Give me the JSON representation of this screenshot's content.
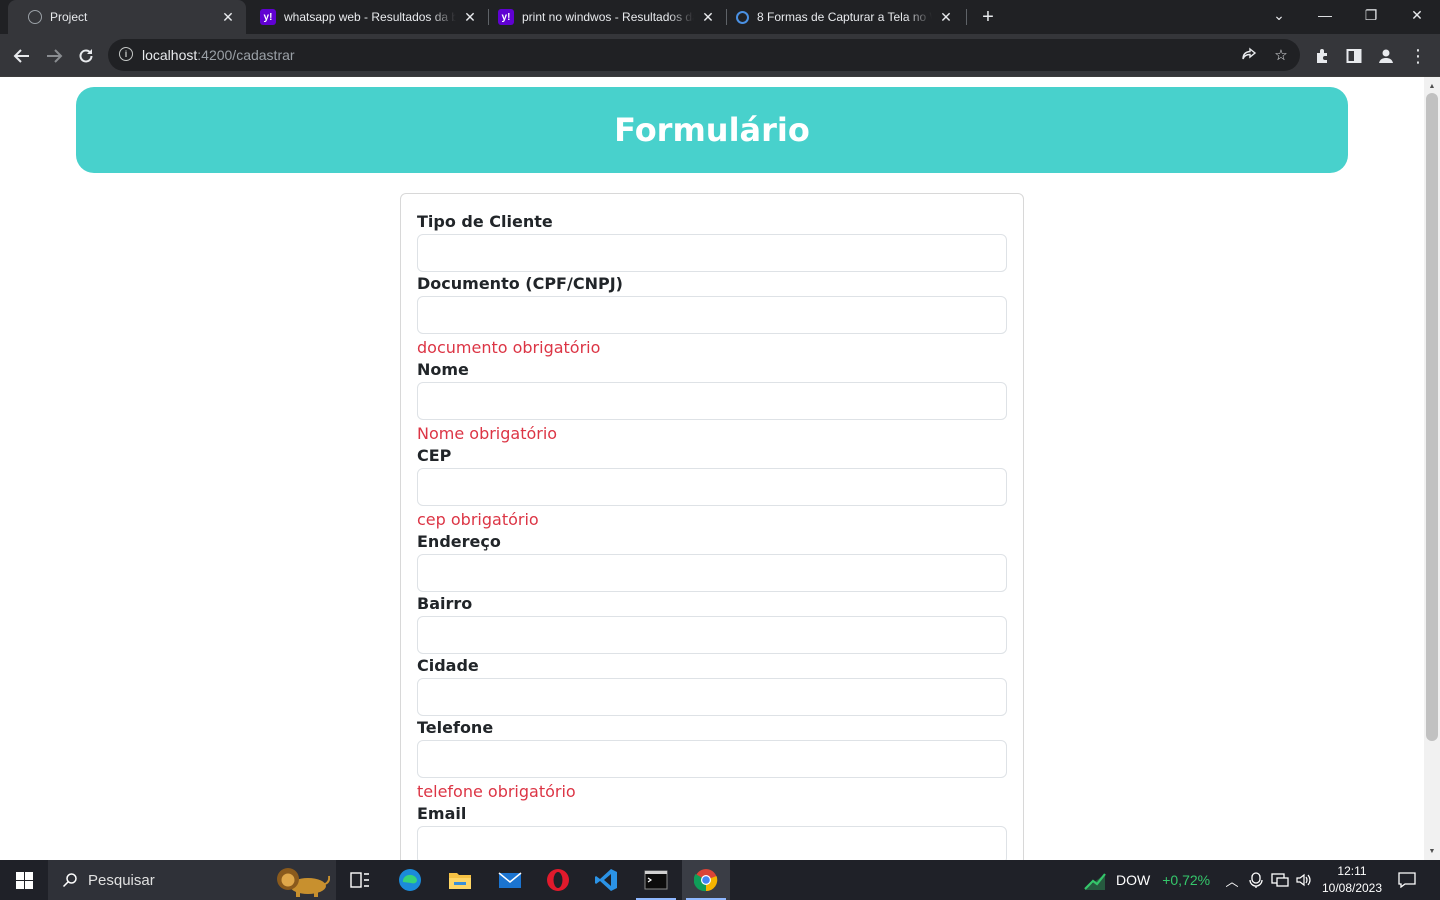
{
  "browser": {
    "tabs": [
      {
        "title": "Project",
        "favicon": "globe-icon"
      },
      {
        "title": "whatsapp web - Resultados da busca",
        "favicon": "yahoo-icon"
      },
      {
        "title": "print no windwos - Resultados da busca",
        "favicon": "yahoo-icon"
      },
      {
        "title": "8 Formas de Capturar a Tela no Windows",
        "favicon": "site-icon"
      }
    ],
    "yahoo_glyph": "y!",
    "url_host": "localhost",
    "url_path": ":4200/cadastrar"
  },
  "page": {
    "header_title": "Formulário",
    "fields": [
      {
        "label": "Tipo de Cliente",
        "value": "",
        "error": ""
      },
      {
        "label": "Documento (CPF/CNPJ)",
        "value": "",
        "error": "documento obrigatório"
      },
      {
        "label": "Nome",
        "value": "",
        "error": "Nome obrigatório"
      },
      {
        "label": "CEP",
        "value": "",
        "error": "cep obrigatório"
      },
      {
        "label": "Endereço",
        "value": "",
        "error": ""
      },
      {
        "label": "Bairro",
        "value": "",
        "error": ""
      },
      {
        "label": "Cidade",
        "value": "",
        "error": ""
      },
      {
        "label": "Telefone",
        "value": "",
        "error": "telefone obrigatório"
      },
      {
        "label": "Email",
        "value": "",
        "error": ""
      }
    ]
  },
  "taskbar": {
    "search_placeholder": "Pesquisar",
    "ticker_name": "DOW",
    "ticker_change": "+0,72%",
    "time": "12:11",
    "date": "10/08/2023"
  },
  "colors": {
    "banner": "#48d1cc",
    "error": "#dc3545",
    "chrome_dark": "#202124"
  }
}
